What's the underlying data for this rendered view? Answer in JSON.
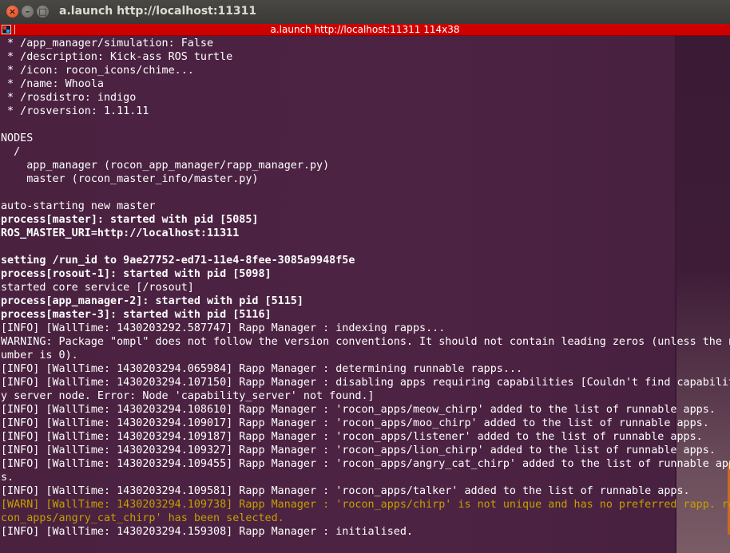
{
  "window": {
    "title": "a.launch http://localhost:11311",
    "close_glyph": "×",
    "min_glyph": "–",
    "max_glyph": "□"
  },
  "tab": {
    "label": "a.launch http://localhost:11311 114x38",
    "icon": "terminal-icon"
  },
  "colors": {
    "terminal_bg": "#4d2343",
    "tabbar": "#cc0000",
    "warn_text": "#c4a000",
    "text": "#ffffff"
  },
  "terminal": {
    "lines": [
      {
        "text": " * /app_manager/simulation: False",
        "style": "normal"
      },
      {
        "text": " * /description: Kick-ass ROS turtle",
        "style": "normal"
      },
      {
        "text": " * /icon: rocon_icons/chime...",
        "style": "normal"
      },
      {
        "text": " * /name: Whoola",
        "style": "normal"
      },
      {
        "text": " * /rosdistro: indigo",
        "style": "normal"
      },
      {
        "text": " * /rosversion: 1.11.11",
        "style": "normal"
      },
      {
        "text": "",
        "style": "normal"
      },
      {
        "text": "NODES",
        "style": "normal"
      },
      {
        "text": "  /",
        "style": "normal"
      },
      {
        "text": "    app_manager (rocon_app_manager/rapp_manager.py)",
        "style": "normal"
      },
      {
        "text": "    master (rocon_master_info/master.py)",
        "style": "normal"
      },
      {
        "text": "",
        "style": "normal"
      },
      {
        "text": "auto-starting new master",
        "style": "normal"
      },
      {
        "text": "process[master]: started with pid [5085]",
        "style": "bold"
      },
      {
        "text": "ROS_MASTER_URI=http://localhost:11311",
        "style": "bold"
      },
      {
        "text": "",
        "style": "normal"
      },
      {
        "text": "setting /run_id to 9ae27752-ed71-11e4-8fee-3085a9948f5e",
        "style": "bold"
      },
      {
        "text": "process[rosout-1]: started with pid [5098]",
        "style": "bold"
      },
      {
        "text": "started core service [/rosout]",
        "style": "normal"
      },
      {
        "text": "process[app_manager-2]: started with pid [5115]",
        "style": "bold"
      },
      {
        "text": "process[master-3]: started with pid [5116]",
        "style": "bold"
      },
      {
        "text": "[INFO] [WallTime: 1430203292.587747] Rapp Manager : indexing rapps...",
        "style": "normal"
      },
      {
        "text": "WARNING: Package \"ompl\" does not follow the version conventions. It should not contain leading zeros (unless the n",
        "style": "normal"
      },
      {
        "text": "umber is 0).",
        "style": "normal"
      },
      {
        "text": "[INFO] [WallTime: 1430203294.065984] Rapp Manager : determining runnable rapps...",
        "style": "normal"
      },
      {
        "text": "[INFO] [WallTime: 1430203294.107150] Rapp Manager : disabling apps requiring capabilities [Couldn't find capabilit",
        "style": "normal"
      },
      {
        "text": "y server node. Error: Node 'capability_server' not found.]",
        "style": "normal"
      },
      {
        "text": "[INFO] [WallTime: 1430203294.108610] Rapp Manager : 'rocon_apps/meow_chirp' added to the list of runnable apps.",
        "style": "normal"
      },
      {
        "text": "[INFO] [WallTime: 1430203294.109017] Rapp Manager : 'rocon_apps/moo_chirp' added to the list of runnable apps.",
        "style": "normal"
      },
      {
        "text": "[INFO] [WallTime: 1430203294.109187] Rapp Manager : 'rocon_apps/listener' added to the list of runnable apps.",
        "style": "normal"
      },
      {
        "text": "[INFO] [WallTime: 1430203294.109327] Rapp Manager : 'rocon_apps/lion_chirp' added to the list of runnable apps.",
        "style": "normal"
      },
      {
        "text": "[INFO] [WallTime: 1430203294.109455] Rapp Manager : 'rocon_apps/angry_cat_chirp' added to the list of runnable app",
        "style": "normal"
      },
      {
        "text": "s.",
        "style": "normal"
      },
      {
        "text": "[INFO] [WallTime: 1430203294.109581] Rapp Manager : 'rocon_apps/talker' added to the list of runnable apps.",
        "style": "normal"
      },
      {
        "text": "[WARN] [WallTime: 1430203294.109738] Rapp Manager : 'rocon_apps/chirp' is not unique and has no preferred rapp. ro",
        "style": "warn"
      },
      {
        "text": "con_apps/angry_cat_chirp' has been selected.",
        "style": "warn"
      },
      {
        "text": "[INFO] [WallTime: 1430203294.159308] Rapp Manager : initialised.",
        "style": "normal"
      }
    ]
  }
}
